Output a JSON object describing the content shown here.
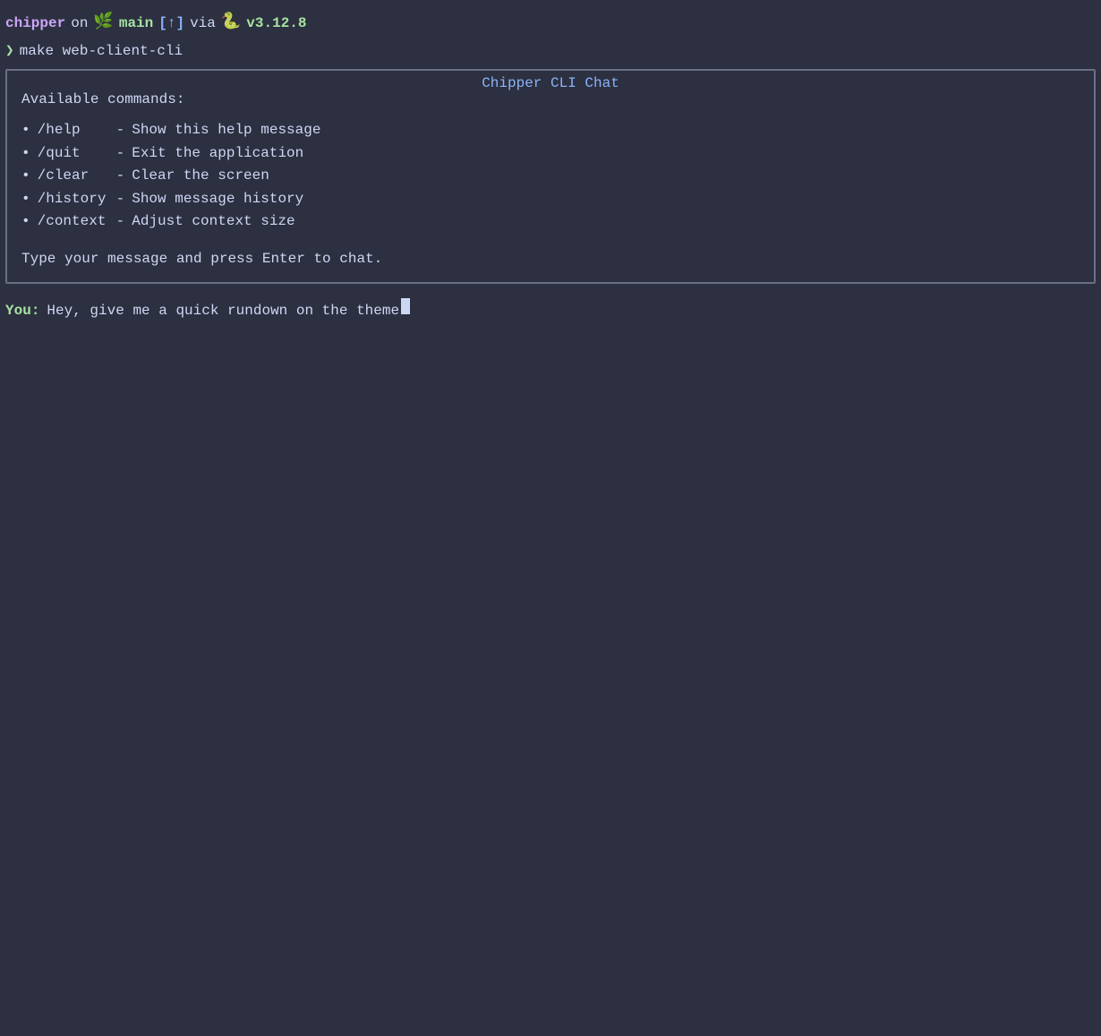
{
  "topbar": {
    "hostname": "chipper",
    "on": "on",
    "branch_icon": "🌿",
    "branch": "main",
    "sync_badge": "[↑]",
    "via": "via",
    "lang_icon": "🐍",
    "version": "v3.12.8"
  },
  "prompt": {
    "arrow": "❯",
    "command": "make web-client-cli"
  },
  "chat_title": "Chipper CLI Chat",
  "help_box": {
    "header": "Available commands:",
    "commands": [
      {
        "name": "/help   ",
        "dash": "-",
        "desc": "Show this help message"
      },
      {
        "name": "/quit   ",
        "dash": "-",
        "desc": "Exit the application"
      },
      {
        "name": "/clear  ",
        "dash": "-",
        "desc": "Clear the screen"
      },
      {
        "name": "/history",
        "dash": "-",
        "desc": "Show message history"
      },
      {
        "name": "/context",
        "dash": "-",
        "desc": "Adjust context size"
      }
    ],
    "tip": "Type your message and press Enter to chat."
  },
  "user_message": {
    "label": "You",
    "colon": ":",
    "text": "Hey, give me a quick rundown on the theme"
  }
}
